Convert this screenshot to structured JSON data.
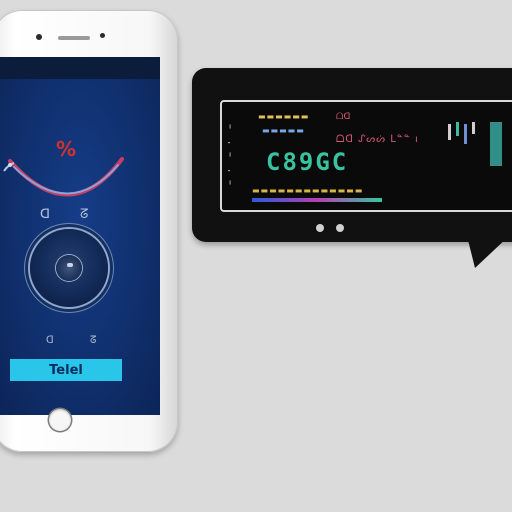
{
  "phone": {
    "gauge_symbol": "%",
    "readout_left": "ᗡ",
    "readout_right": "ᘔ",
    "knob_label_left": "ᗡ",
    "knob_label_right": "ᘔ",
    "action_button_label": "Telel"
  },
  "panel": {
    "display": {
      "top_left": "▬▬▬▬▬▬",
      "top_mid": "ᗝᗡ",
      "row_2": "▬▬▬▬▬",
      "row_2b": "ᗝᗡ ᔑᔕᔖ ᒪᓐᓐ ı",
      "big_text": "C89GC",
      "bottom": "▬▬▬▬▬▬▬▬▬▬▬▬▬"
    }
  },
  "colors": {
    "screen_blue": "#10306e",
    "accent_cyan": "#29c6ea",
    "display_green": "#39c3a0",
    "display_pink": "#d95a77",
    "display_yellow": "#e3c15a"
  }
}
